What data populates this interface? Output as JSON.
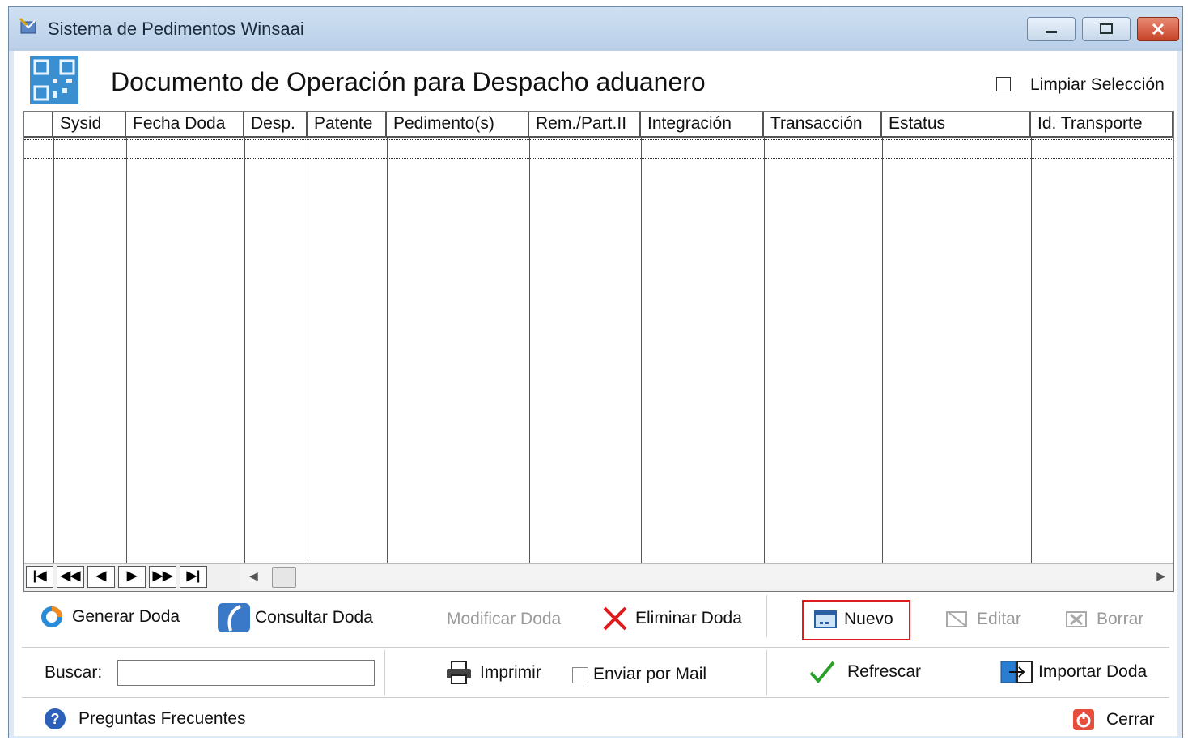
{
  "window": {
    "title": "Sistema de Pedimentos Winsaai"
  },
  "header": {
    "title": "Documento de Operación para Despacho aduanero",
    "clear_selection_label": "Limpiar Selección"
  },
  "grid": {
    "columns": [
      "Sysid",
      "Fecha Doda",
      "Desp.",
      "Patente",
      "Pedimento(s)",
      "Rem./Part.II",
      "Integración",
      "Transacción",
      "Estatus",
      "Id. Transporte"
    ],
    "rows": []
  },
  "navigator": {
    "buttons": [
      "first",
      "prev-page",
      "prev",
      "next",
      "next-page",
      "last"
    ]
  },
  "actions": {
    "generar": "Generar Doda",
    "consultar": "Consultar Doda",
    "modificar": "Modificar Doda",
    "eliminar": "Eliminar Doda",
    "nuevo": "Nuevo",
    "editar": "Editar",
    "borrar": "Borrar"
  },
  "search": {
    "label": "Buscar:",
    "value": ""
  },
  "secondary": {
    "imprimir": "Imprimir",
    "enviar_mail": "Enviar por Mail",
    "refrescar": "Refrescar",
    "importar": "Importar Doda"
  },
  "footer": {
    "faq": "Preguntas Frecuentes",
    "cerrar": "Cerrar"
  },
  "colors": {
    "highlight": "#e01b1b",
    "accent_blue": "#2a8bd6",
    "check_green": "#2aa22a"
  }
}
